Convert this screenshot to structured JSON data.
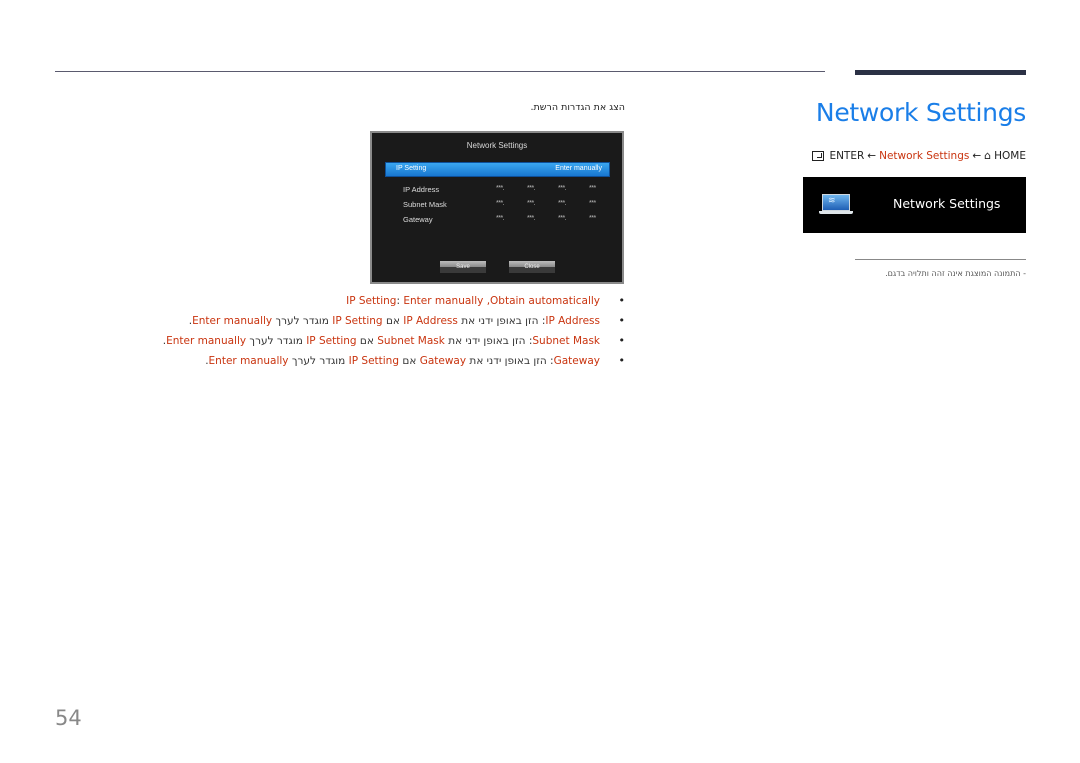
{
  "header": {
    "title": "Network Settings",
    "breadcrumb": {
      "enter_label": "ENTER",
      "arrow": "←",
      "middle": "Network Settings",
      "home_label": "HOME"
    }
  },
  "menu_box": {
    "label": "Network Settings",
    "icon": "laptop-wifi-icon"
  },
  "note": "-   התמונה המוצגת אינה זהה ותלויה בדגם.",
  "intro": "הצג את הגדרות הרשת.",
  "tv_screen": {
    "title": "Network Settings",
    "selected_row": {
      "label": "IP Setting",
      "value": "Enter manually"
    },
    "rows": [
      {
        "label": "IP Address",
        "values": [
          "***.",
          "***.",
          "***.",
          "***"
        ]
      },
      {
        "label": "Subnet Mask",
        "values": [
          "***.",
          "***.",
          "***.",
          "***"
        ]
      },
      {
        "label": "Gateway",
        "values": [
          "***.",
          "***.",
          "***.",
          "***"
        ]
      }
    ],
    "buttons": {
      "save": "Save",
      "close": "Close"
    }
  },
  "bullets": [
    {
      "key": "IP Setting",
      "sep": ": ",
      "text": "",
      "tail": "Enter manually ,Obtain automatically"
    },
    {
      "key": "IP Address",
      "sep": ": ",
      "p1": "הזן באופן ידני את ",
      "k2": "IP Address",
      "p2": " אם ",
      "k3": "IP Setting",
      "p3": " מוגדר לערך ",
      "k4": "Enter manually",
      "end": "."
    },
    {
      "key": "Subnet Mask",
      "sep": ": ",
      "p1": "הזן באופן ידני את ",
      "k2": "Subnet Mask",
      "p2": " אם ",
      "k3": "IP Setting",
      "p3": " מוגדר לערך ",
      "k4": "Enter manually",
      "end": "."
    },
    {
      "key": "Gateway",
      "sep": ": ",
      "p1": "הזן באופן ידני את ",
      "k2": "Gateway",
      "p2": " אם ",
      "k3": "IP Setting",
      "p3": " מוגדר לערך ",
      "k4": "Enter manually",
      "end": "."
    }
  ],
  "page_number": "54",
  "colors": {
    "title_blue": "#1a7ee8",
    "accent_red": "#c9340f",
    "bar_dark": "#2b3145"
  }
}
